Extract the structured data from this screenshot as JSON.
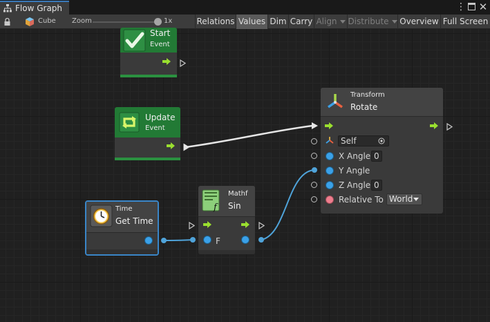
{
  "window": {
    "tab_title": "Flow Graph",
    "icons": {
      "tab": "flow-graph-icon",
      "more": "more-vertical-icon",
      "maximize": "maximize-icon",
      "close": "close-icon"
    }
  },
  "toolbar": {
    "asset_name": "Cube",
    "zoom_label": "Zoom",
    "zoom_value": "1x",
    "zoom_level": 1.0,
    "buttons": {
      "relations": "Relations",
      "values": "Values",
      "dim": "Dim",
      "carry": "Carry",
      "align": "Align",
      "distribute": "Distribute",
      "overview": "Overview",
      "full_screen": "Full Screen"
    },
    "active_buttons": [
      "Values"
    ],
    "disabled_buttons": [
      "Align",
      "Distribute"
    ]
  },
  "nodes": {
    "start": {
      "title": "Start",
      "subtitle": "Event",
      "icon": "checkmark-icon"
    },
    "update": {
      "title": "Update",
      "subtitle": "Event",
      "icon": "update-loop-icon"
    },
    "rotate": {
      "subtitle": "Transform",
      "title": "Rotate",
      "icon": "transform-axes-icon",
      "target_value": "Self",
      "rows": {
        "x_angle": {
          "label": "X Angle",
          "value": "0"
        },
        "y_angle": {
          "label": "Y Angle"
        },
        "z_angle": {
          "label": "Z Angle",
          "value": "0"
        },
        "relative_to": {
          "label": "Relative To",
          "value": "World"
        }
      }
    },
    "time": {
      "subtitle": "Time",
      "title": "Get Time",
      "icon": "stopwatch-icon"
    },
    "sin": {
      "subtitle": "Mathf",
      "title": "Sin",
      "input_label": "F",
      "icon": "math-function-icon"
    }
  },
  "colors": {
    "event_header": "#227a35",
    "selection_outline": "#3a86c8",
    "float_port": "#3ba1e8",
    "flow_port": "#9adf2f",
    "enum_port": "#ef7e8e",
    "tab_accent": "#3a79bb"
  }
}
